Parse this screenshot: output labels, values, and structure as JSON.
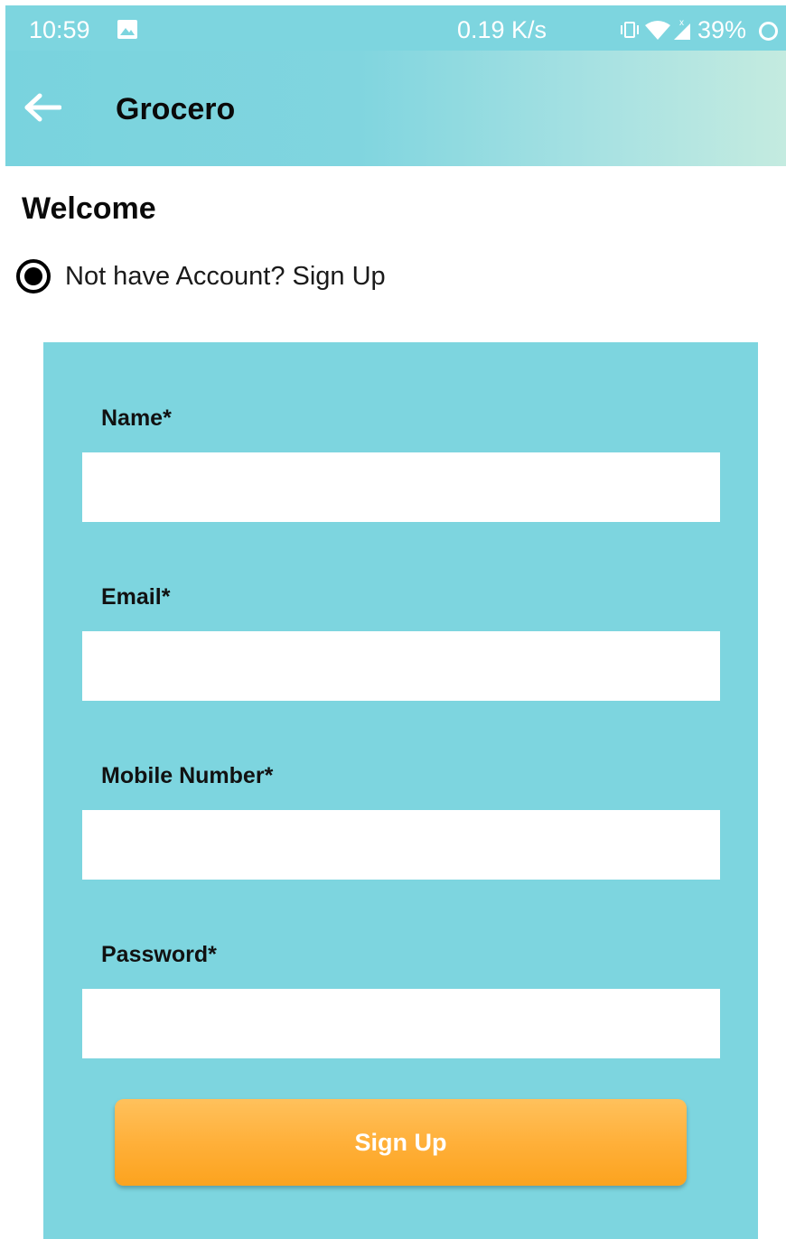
{
  "status_bar": {
    "time": "10:59",
    "network_speed": "0.19 K/s",
    "battery": "39%",
    "icons": [
      "gallery-icon",
      "vibrate-icon",
      "wifi-icon",
      "signal-icon",
      "battery-ring-icon"
    ]
  },
  "app_bar": {
    "title": "Grocero",
    "back_icon": "back-arrow-icon"
  },
  "welcome": {
    "heading": "Welcome",
    "radio_label": "Not have Account? Sign Up",
    "radio_selected": true
  },
  "form": {
    "name_label": "Name*",
    "name_value": "",
    "email_label": "Email*",
    "email_value": "",
    "mobile_label": "Mobile Number*",
    "mobile_value": "",
    "password_label": "Password*",
    "password_value": "",
    "submit_label": "Sign Up"
  },
  "colors": {
    "accent": "#7dd5df",
    "button": "#fcaa2e",
    "text": "#0a0a0a"
  }
}
